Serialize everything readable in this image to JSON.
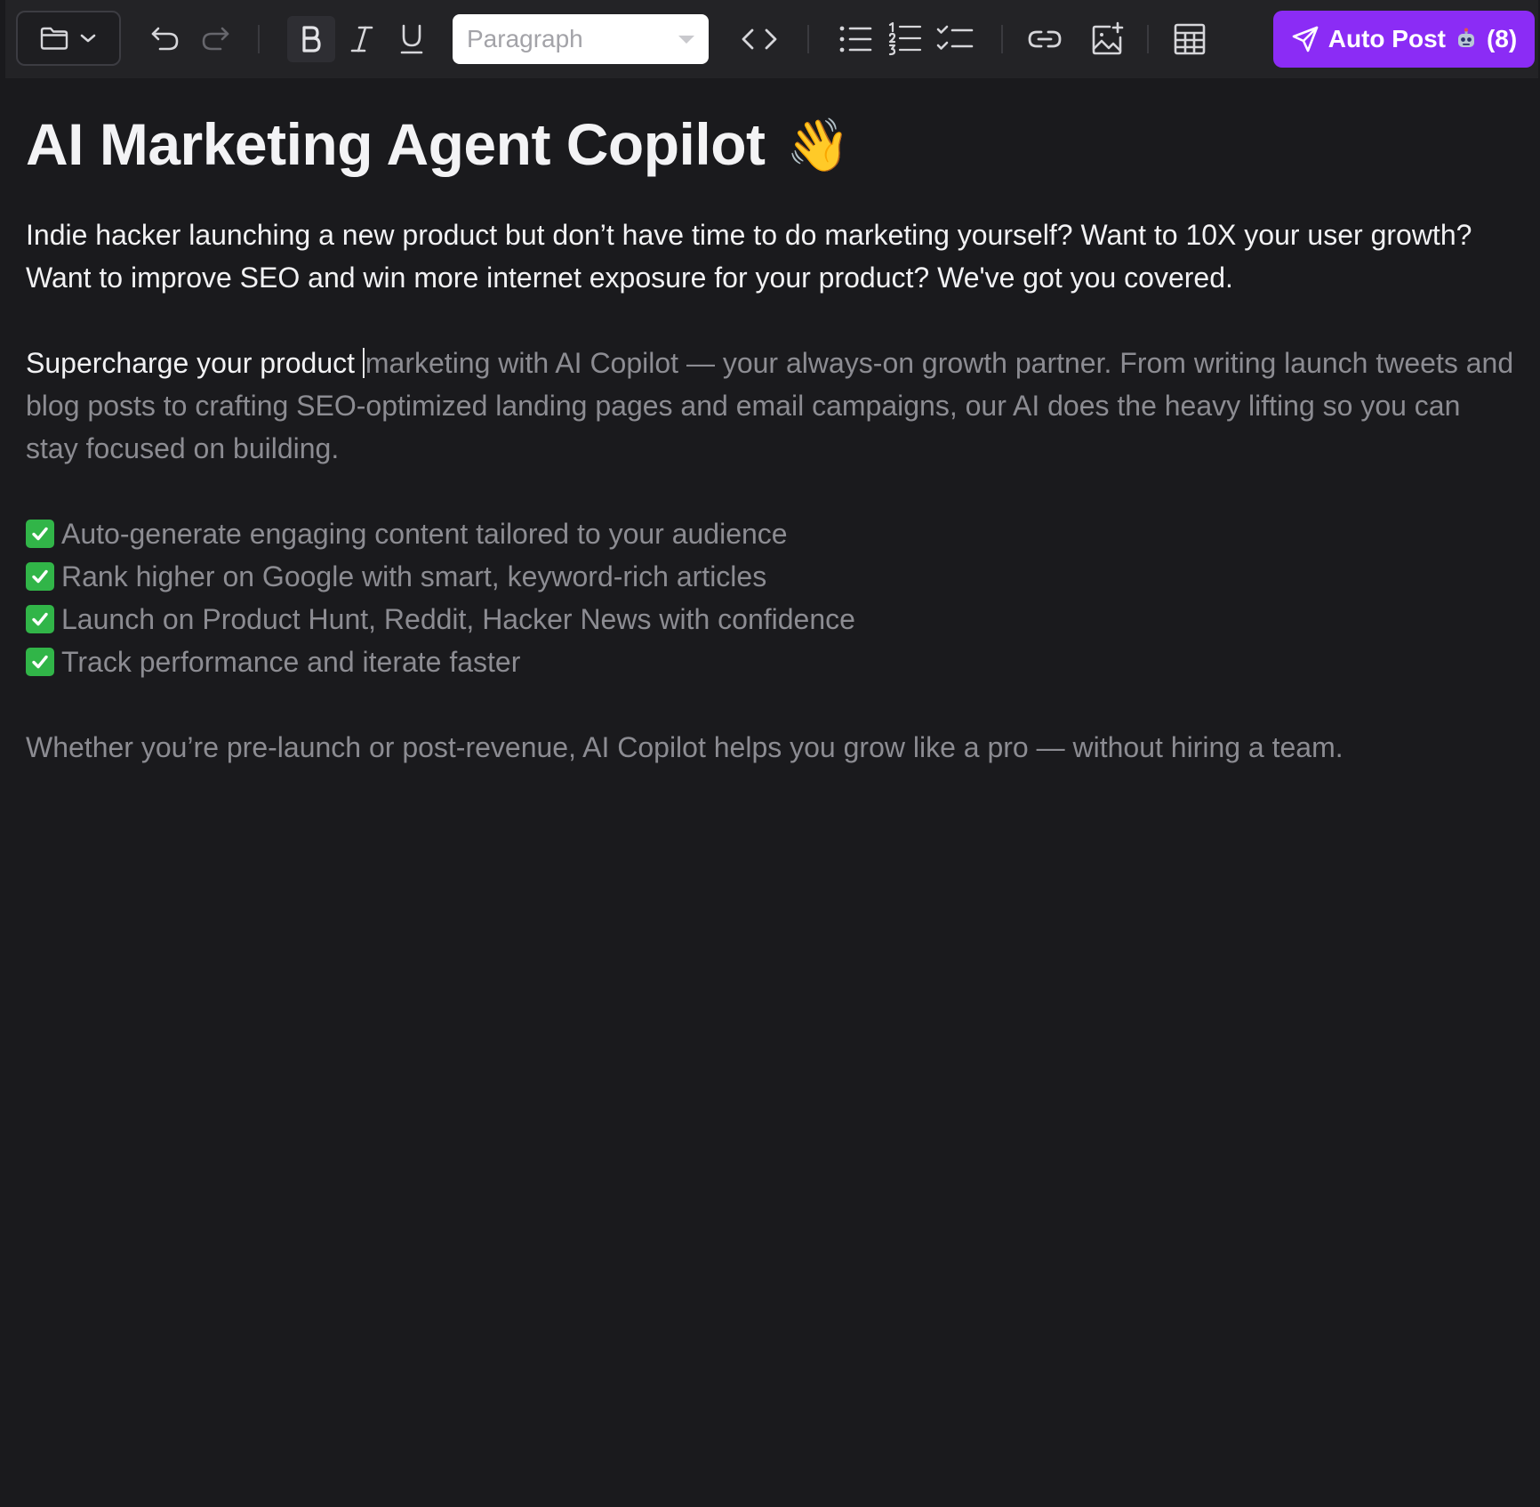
{
  "toolbar": {
    "block_type": "Paragraph",
    "auto_post_label": "Auto Post",
    "auto_post_count": "(8)",
    "accent": "#8b2cf5",
    "icons": [
      "folder-icon",
      "chevron-down-icon",
      "undo-icon",
      "redo-icon",
      "bold-icon",
      "italic-icon",
      "underline-icon",
      "code-icon",
      "bullet-list-icon",
      "numbered-list-icon",
      "task-list-icon",
      "link-icon",
      "add-image-icon",
      "table-icon",
      "send-icon",
      "robot-icon"
    ]
  },
  "editor": {
    "title": "AI Marketing Agent Copilot",
    "title_emoji": "👋",
    "intro": "Indie hacker launching a new product but don’t have time to do marketing yourself? Want to 10X your user growth? Want to improve SEO and win more internet exposure for your product? We've got you covered.",
    "typed_text": "Supercharge your product ",
    "suggestion_text": "marketing with AI Copilot — your always-on growth partner. From writing launch tweets and blog posts to crafting SEO-optimized landing pages and email campaigns, our AI does the heavy lifting so you can stay focused on building.",
    "features": [
      "Auto-generate engaging content tailored to your audience",
      "Rank higher on Google with smart, keyword-rich articles",
      "Launch on Product Hunt, Reddit, Hacker News with confidence",
      "Track performance and iterate faster"
    ],
    "closing": "Whether you’re pre-launch or post-revenue, AI Copilot helps you grow like a pro — without hiring a team."
  }
}
